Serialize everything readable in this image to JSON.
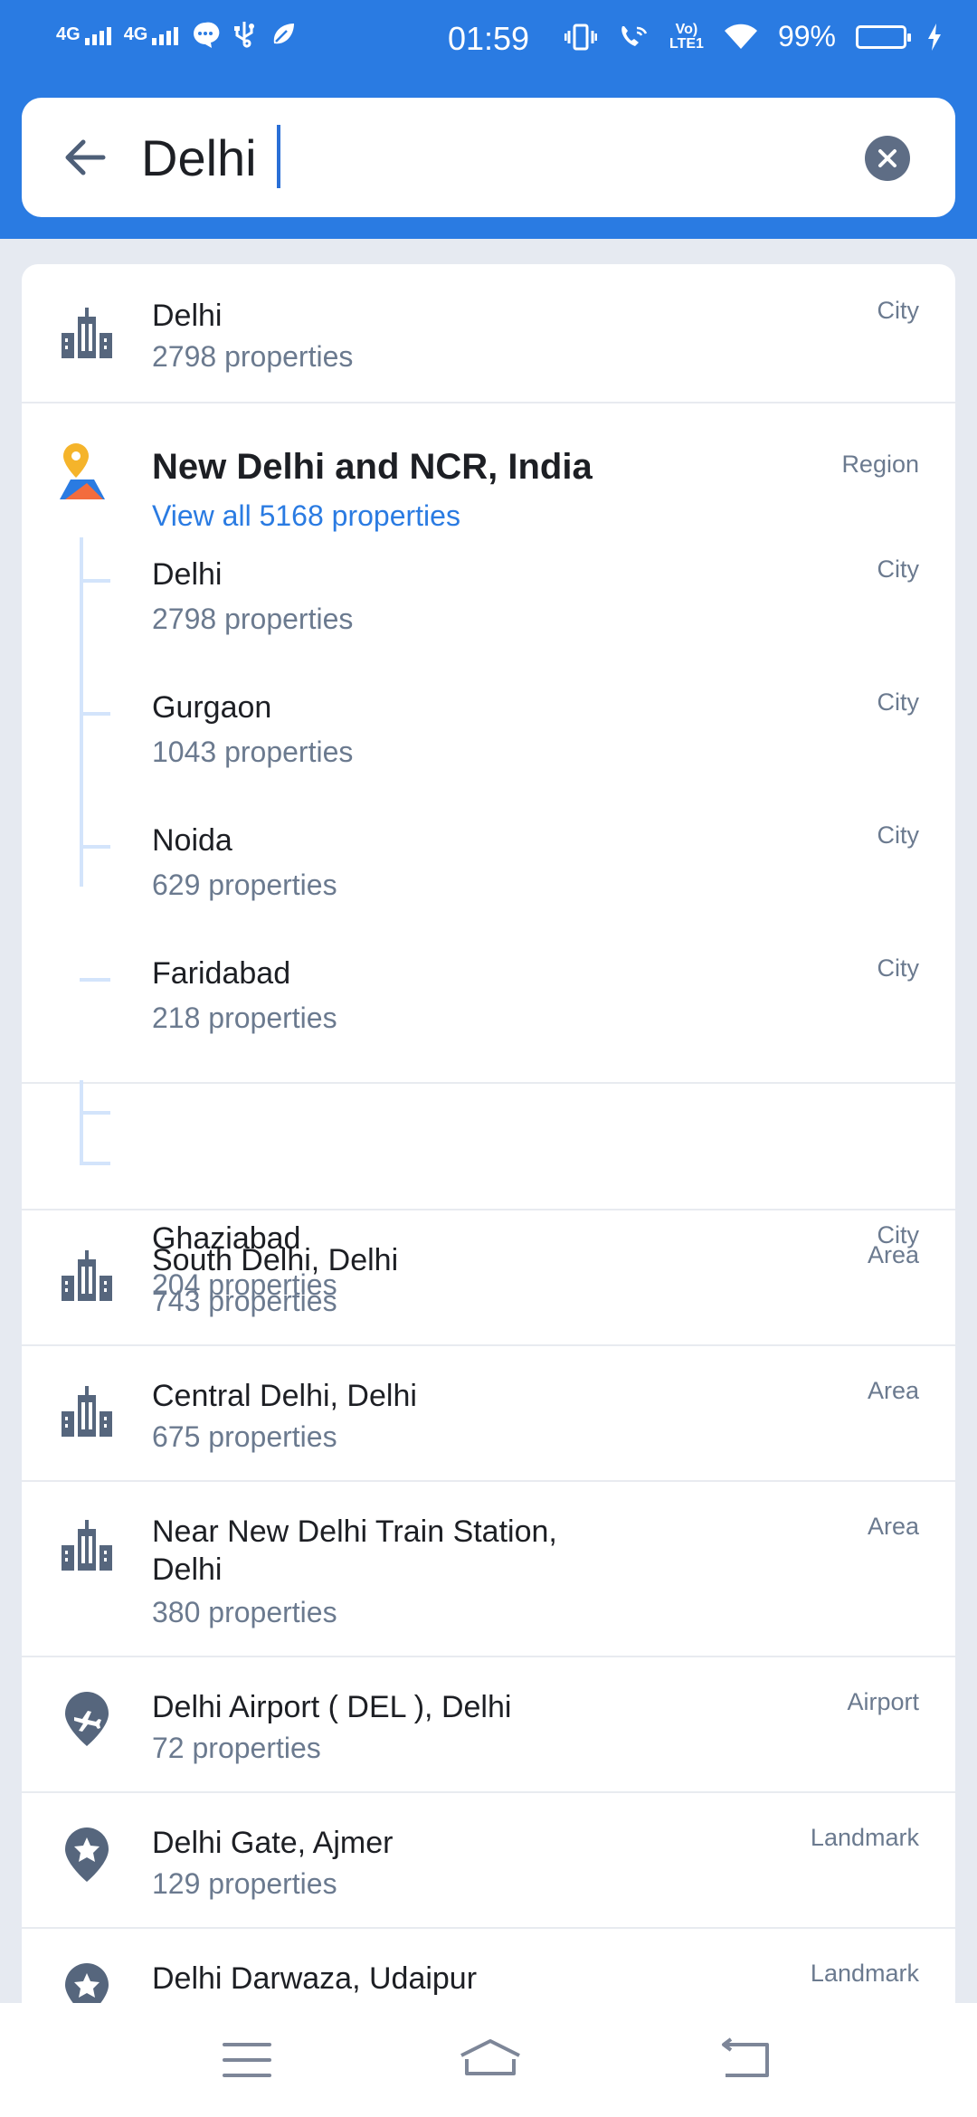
{
  "status_bar": {
    "net1": "4G",
    "net2": "4G",
    "time": "01:59",
    "volte": "Vo) LTE1",
    "battery": "99%"
  },
  "search": {
    "query": "Delhi",
    "placeholder": ""
  },
  "top_result": {
    "name": "Delhi",
    "count": "2798 properties",
    "type": "City",
    "icon": "city-icon"
  },
  "region": {
    "title": "New Delhi and NCR, India",
    "link": "View all 5168 properties",
    "type": "Region",
    "icon": "region-pin-icon",
    "children": [
      {
        "name": "Delhi",
        "count": "2798 properties",
        "type": "City"
      },
      {
        "name": "Gurgaon",
        "count": "1043 properties",
        "type": "City"
      },
      {
        "name": "Noida",
        "count": "629 properties",
        "type": "City"
      },
      {
        "name": "Faridabad",
        "count": "218 properties",
        "type": "City"
      },
      {
        "name": "Ghaziabad",
        "count": "204 properties",
        "type": "City"
      }
    ]
  },
  "results": [
    {
      "name": "South Delhi, Delhi",
      "count": "743 properties",
      "type": "Area",
      "icon": "city-icon"
    },
    {
      "name": "Central Delhi, Delhi",
      "count": "675 properties",
      "type": "Area",
      "icon": "city-icon"
    },
    {
      "name": "Near New Delhi Train Station,",
      "name2": "Delhi",
      "count": "380 properties",
      "type": "Area",
      "icon": "city-icon"
    },
    {
      "name": "Delhi Airport ( DEL ), Delhi",
      "count": "72 properties",
      "type": "Airport",
      "icon": "airport-pin-icon"
    },
    {
      "name": "Delhi Gate, Ajmer",
      "count": "129 properties",
      "type": "Landmark",
      "icon": "landmark-pin-icon"
    },
    {
      "name": "Delhi Darwaza, Udaipur",
      "type": "Landmark",
      "icon": "landmark-pin-icon"
    }
  ],
  "colors": {
    "accent": "#2a7be2",
    "muted": "#6b7a8f",
    "icon": "#56667d",
    "text": "#1d1f24"
  }
}
